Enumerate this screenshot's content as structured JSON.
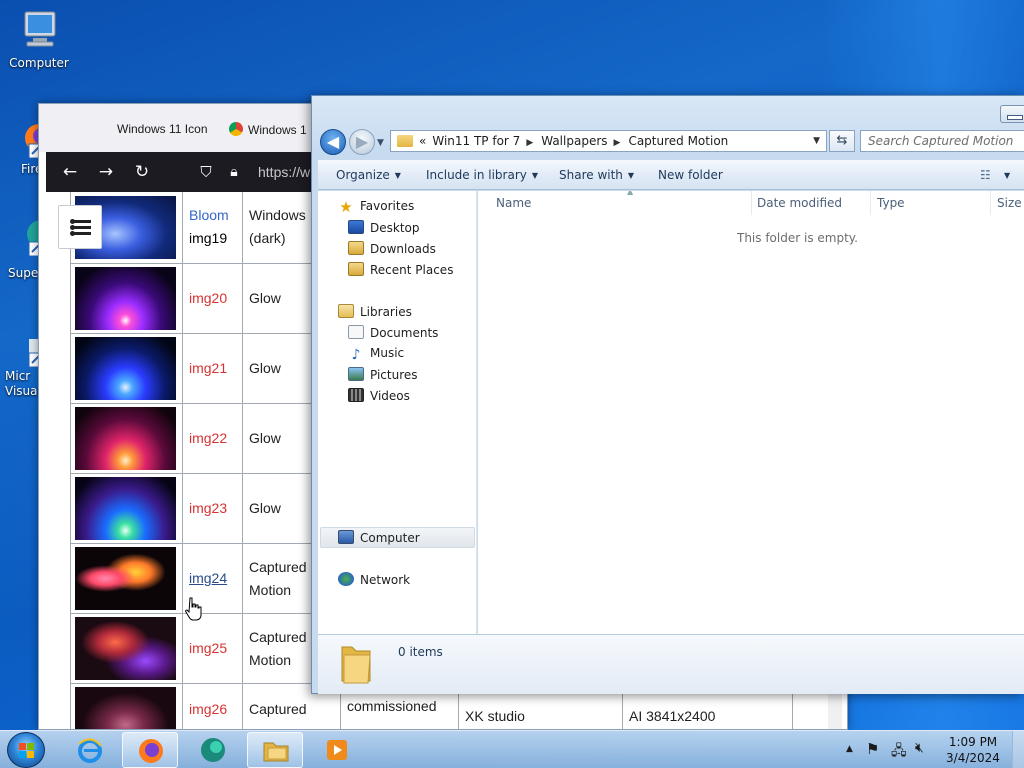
{
  "desktop": {
    "icons": [
      {
        "label": "Computer"
      },
      {
        "label": "Fire"
      },
      {
        "label": "Super"
      },
      {
        "label": "Micr\nVisual"
      }
    ]
  },
  "browser": {
    "tabs": [
      "Windows 11 Icon",
      "Windows 1"
    ],
    "url": "https://wi",
    "rows": [
      {
        "name_top": "Bloom",
        "name_bottom": "img19",
        "category": "Windows (dark)",
        "name_color": "blue"
      },
      {
        "name": "img20",
        "category": "Glow",
        "name_color": "red"
      },
      {
        "name": "img21",
        "category": "Glow",
        "name_color": "red"
      },
      {
        "name": "img22",
        "category": "Glow",
        "name_color": "red"
      },
      {
        "name": "img23",
        "category": "Glow",
        "name_color": "red"
      },
      {
        "name": "img24",
        "category": "Captured Motion",
        "name_color": "visited"
      },
      {
        "name": "img25",
        "category": "Captured Motion",
        "name_color": "red"
      },
      {
        "name": "img26",
        "category": "Captured",
        "author": "commissioned",
        "source": "XK studio",
        "resolution": "AI 3841x2400"
      }
    ]
  },
  "explorer": {
    "breadcrumb": {
      "prefix": "«",
      "segments": [
        "Win11 TP for 7",
        "Wallpapers",
        "Captured Motion"
      ]
    },
    "search_placeholder": "Search Captured Motion",
    "commands": {
      "organize": "Organize",
      "include": "Include in library",
      "share": "Share with",
      "newfolder": "New folder"
    },
    "nav": {
      "favorites": "Favorites",
      "desktop": "Desktop",
      "downloads": "Downloads",
      "recent": "Recent Places",
      "libraries": "Libraries",
      "documents": "Documents",
      "music": "Music",
      "pictures": "Pictures",
      "videos": "Videos",
      "computer": "Computer",
      "network": "Network"
    },
    "columns": {
      "name": "Name",
      "date": "Date modified",
      "type": "Type",
      "size": "Size"
    },
    "empty_message": "This folder is empty.",
    "item_count": "0 items"
  },
  "taskbar": {
    "time": "1:09 PM",
    "date": "3/4/2024",
    "tray_up": "▲"
  }
}
